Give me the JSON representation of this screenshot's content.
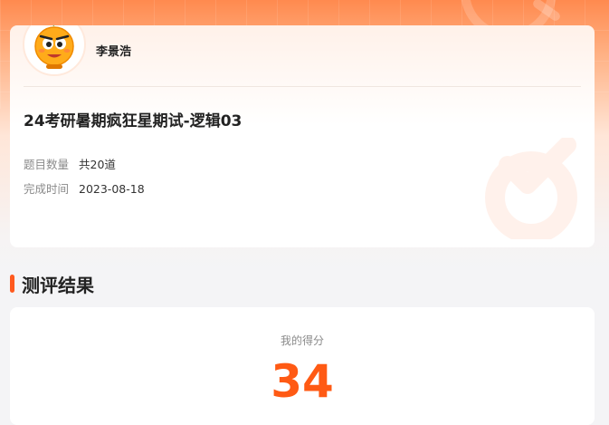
{
  "user": {
    "name": "李景浩",
    "avatar_icon": "orange-mascot-icon"
  },
  "exam": {
    "title": "24考研暑期疯狂星期试-逻辑03",
    "question_count_label": "题目数量",
    "question_count_value": "共20道",
    "completion_time_label": "完成时间",
    "completion_time_value": "2023-08-18"
  },
  "result": {
    "section_title": "测评结果",
    "score_label": "我的得分",
    "score_value": "34"
  },
  "colors": {
    "accent": "#ff5a14",
    "header_gradient_top": "#ff8a4f"
  }
}
